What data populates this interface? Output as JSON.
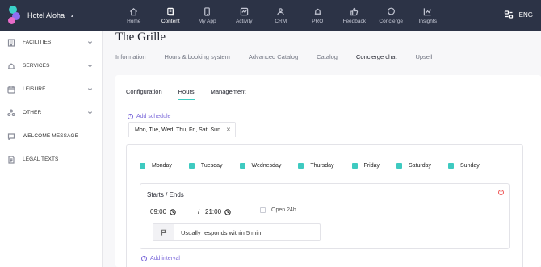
{
  "app": {
    "brand_name": "Hotel Aloha",
    "lang": "ENG",
    "colors": {
      "topbar": "#2c3346",
      "accent": "#3ecac0",
      "link": "#7a68d9"
    }
  },
  "nav": [
    {
      "label": "Home",
      "icon": "home-icon"
    },
    {
      "label": "Content",
      "icon": "content-icon",
      "active": true
    },
    {
      "label": "My App",
      "icon": "phone-icon"
    },
    {
      "label": "Activity",
      "icon": "activity-icon"
    },
    {
      "label": "CRM",
      "icon": "users-icon"
    },
    {
      "label": "PRO",
      "icon": "bell-icon"
    },
    {
      "label": "Feedback",
      "icon": "thumbs-up-icon"
    },
    {
      "label": "Concierge",
      "icon": "chat-icon"
    },
    {
      "label": "Insights",
      "icon": "chart-icon"
    }
  ],
  "sidebar": {
    "items": [
      {
        "label": "FACILITIES",
        "icon": "building-icon",
        "expandable": true
      },
      {
        "label": "SERVICES",
        "icon": "bell-icon",
        "expandable": true
      },
      {
        "label": "LEISURE",
        "icon": "calendar-icon",
        "expandable": true
      },
      {
        "label": "OTHER",
        "icon": "dots-icon",
        "expandable": true
      },
      {
        "label": "WELCOME MESSAGE",
        "icon": "message-icon",
        "expandable": false
      },
      {
        "label": "LEGAL TEXTS",
        "icon": "document-icon",
        "expandable": false
      }
    ]
  },
  "page": {
    "title": "The Grille",
    "tabs": [
      "Information",
      "Hours & booking system",
      "Advanced Catalog",
      "Catalog",
      "Concierge chat",
      "Upsell"
    ],
    "active_tab": "Concierge chat",
    "subtabs": [
      "Configuration",
      "Hours",
      "Management"
    ],
    "active_subtab": "Hours"
  },
  "schedule": {
    "add_schedule_label": "Add schedule",
    "days_tab_label": "Mon, Tue, Wed, Thu, Fri, Sat, Sun",
    "days": [
      "Monday",
      "Tuesday",
      "Wednesday",
      "Thursday",
      "Friday",
      "Saturday",
      "Sunday"
    ],
    "starts_ends_label": "Starts / Ends",
    "start_time": "09:00",
    "end_time": "21:00",
    "separator": "/",
    "open24_label": "Open 24h",
    "response_text": "Usually responds within 5 min",
    "add_interval_label": "Add interval"
  }
}
